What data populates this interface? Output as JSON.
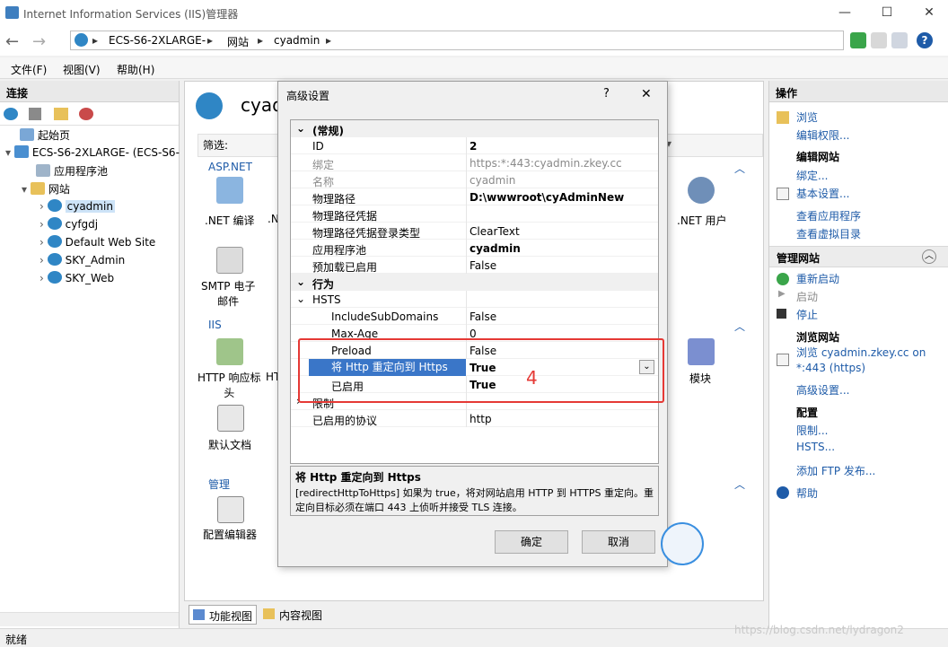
{
  "window": {
    "title": "Internet Information Services (IIS)管理器"
  },
  "nav": {
    "crumbs": [
      "ECS-S6-2XLARGE-",
      "网站",
      "cyadmin"
    ],
    "separator": "▸"
  },
  "menu": {
    "file": "文件(F)",
    "view": "视图(V)",
    "help": "帮助(H)"
  },
  "left": {
    "header": "连接",
    "tree": {
      "start": "起始页",
      "server": "ECS-S6-2XLARGE- (ECS-S6-",
      "apppools": "应用程序池",
      "sites": "网站",
      "site_items": [
        "cyadmin",
        "cyfgdj",
        "Default Web Site",
        "SKY_Admin",
        "SKY_Web"
      ]
    }
  },
  "center": {
    "title": "cyad",
    "filter_label": "筛选:",
    "group_aspnet": "ASP.NET",
    "group_iis": "IIS",
    "group_manage": "管理",
    "features": {
      "net_compile": ".NET 编译",
      "net_partial": ".N",
      "smtp_line1": "SMTP 电子",
      "smtp_line2": "邮件",
      "http_resp_line1": "HTTP 响应标",
      "http_resp_line2": "头",
      "ht_partial": "HT",
      "default_doc": "默认文档",
      "config_editor": "配置编辑器",
      "net_users": ".NET 用户",
      "modules": "模块"
    },
    "tabs": {
      "feature_view": "功能视图",
      "content_view": "内容视图"
    }
  },
  "dialog": {
    "title": "高级设置",
    "help": "?",
    "close": "✕",
    "rows": [
      {
        "key": "(常规)",
        "value": "",
        "type": "category"
      },
      {
        "key": "ID",
        "value": "2",
        "type": "bold"
      },
      {
        "key": "绑定",
        "value": "https:*:443:cyadmin.zkey.cc",
        "type": "gray"
      },
      {
        "key": "名称",
        "value": "cyadmin",
        "type": "gray"
      },
      {
        "key": "物理路径",
        "value": "D:\\wwwroot\\cyAdminNew",
        "type": "bold"
      },
      {
        "key": "物理路径凭据",
        "value": "",
        "type": "normal"
      },
      {
        "key": "物理路径凭据登录类型",
        "value": "ClearText",
        "type": "normal"
      },
      {
        "key": "应用程序池",
        "value": "cyadmin",
        "type": "bold"
      },
      {
        "key": "预加载已启用",
        "value": "False",
        "type": "normal"
      },
      {
        "key": "行为",
        "value": "",
        "type": "category"
      },
      {
        "key": "HSTS",
        "value": "",
        "type": "sub"
      },
      {
        "key": "IncludeSubDomains",
        "value": "False",
        "type": "child"
      },
      {
        "key": "Max-Age",
        "value": "0",
        "type": "child"
      },
      {
        "key": "Preload",
        "value": "False",
        "type": "child"
      },
      {
        "key": "将 Http 重定向到 Https",
        "value": "True",
        "type": "selected"
      },
      {
        "key": "已启用",
        "value": "True",
        "type": "childbold"
      },
      {
        "key": "限制",
        "value": "",
        "type": "sub"
      },
      {
        "key": "已启用的协议",
        "value": "http",
        "type": "normal"
      }
    ],
    "annotation_number": "4",
    "desc_title": "将 Http 重定向到 Https",
    "desc_text": "[redirectHttpToHttps] 如果为 true，将对网站启用 HTTP 到 HTTPS 重定向。重定向目标必须在端口 443 上侦听并接受 TLS 连接。",
    "ok": "确定",
    "cancel": "取消"
  },
  "right": {
    "header": "操作",
    "browse": "浏览",
    "edit_perms": "编辑权限...",
    "edit_site": "编辑网站",
    "bindings": "绑定...",
    "basic_settings": "基本设置...",
    "view_apps": "查看应用程序",
    "view_vdirs": "查看虚拟目录",
    "manage_site": "管理网站",
    "restart": "重新启动",
    "start": "启动",
    "stop": "停止",
    "browse_site": "浏览网站",
    "browse_link_line1": "浏览 cyadmin.zkey.cc on",
    "browse_link_line2": "*:443 (https)",
    "advanced": "高级设置...",
    "config": "配置",
    "limits": "限制...",
    "hsts": "HSTS...",
    "add_ftp": "添加 FTP 发布...",
    "help": "帮助"
  },
  "status": {
    "text": "就绪",
    "watermark": "https://blog.csdn.net/lydragon2"
  },
  "colors": {
    "accent": "#3a76c8",
    "link": "#1e5ba8",
    "highlight_border": "#e53935"
  }
}
